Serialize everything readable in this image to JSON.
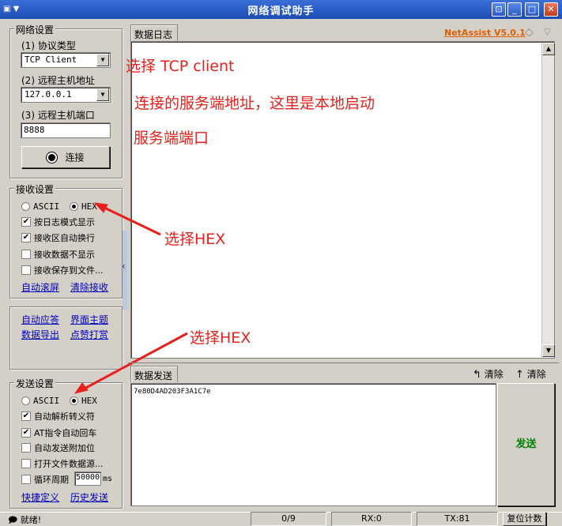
{
  "window": {
    "title": "网络调试助手",
    "brand": "NetAssist V5.0.1"
  },
  "network": {
    "group_title": "网络设置",
    "protocol_label": "(1) 协议类型",
    "protocol_value": "TCP Client",
    "host_label": "(2) 远程主机地址",
    "host_value": "127.0.0.1",
    "port_label": "(3) 远程主机端口",
    "port_value": "8888",
    "connect_label": "连接"
  },
  "receive": {
    "group_title": "接收设置",
    "ascii_label": "ASCII",
    "hex_label": "HEX",
    "options": [
      "按日志模式显示",
      "接收区自动换行",
      "接收数据不显示",
      "接收保存到文件..."
    ],
    "options_checked": [
      true,
      true,
      false,
      false
    ],
    "link_autoscroll": "自动滚屏",
    "link_clear": "清除接收"
  },
  "extras": {
    "auto_reply": "自动应答",
    "theme": "界面主题",
    "export": "数据导出",
    "like": "点赞打赏"
  },
  "send": {
    "group_title": "发送设置",
    "ascii_label": "ASCII",
    "hex_label": "HEX",
    "options": [
      "自动解析转义符",
      "AT指令自动回车",
      "自动发送附加位",
      "打开文件数据源..."
    ],
    "options_checked": [
      true,
      true,
      false,
      false
    ],
    "cycle_label": "循环周期",
    "cycle_value": "50000",
    "cycle_unit": "ms",
    "link_shortcuts": "快捷定义",
    "link_history": "历史发送"
  },
  "log": {
    "tab_label": "数据日志"
  },
  "send_area": {
    "tab_label": "数据发送",
    "clear1": "清除",
    "clear2": "清除",
    "content": "7e80D4AD203F3A1C7e",
    "send_button": "发送"
  },
  "annotations": {
    "a1": "选择 TCP client",
    "a2": "连接的服务端地址，这里是本地启动",
    "a3": "服务端端口",
    "a4": "选择HEX",
    "a5": "选择HEX"
  },
  "status": {
    "ready": "就绪!",
    "count": "0/9",
    "rx": "RX:0",
    "tx": "TX:81",
    "reset": "复位计数"
  },
  "colors": {
    "annotation": "#e8201c",
    "brand": "#e06000",
    "send_text": "#008000",
    "link": "#0000c0"
  }
}
